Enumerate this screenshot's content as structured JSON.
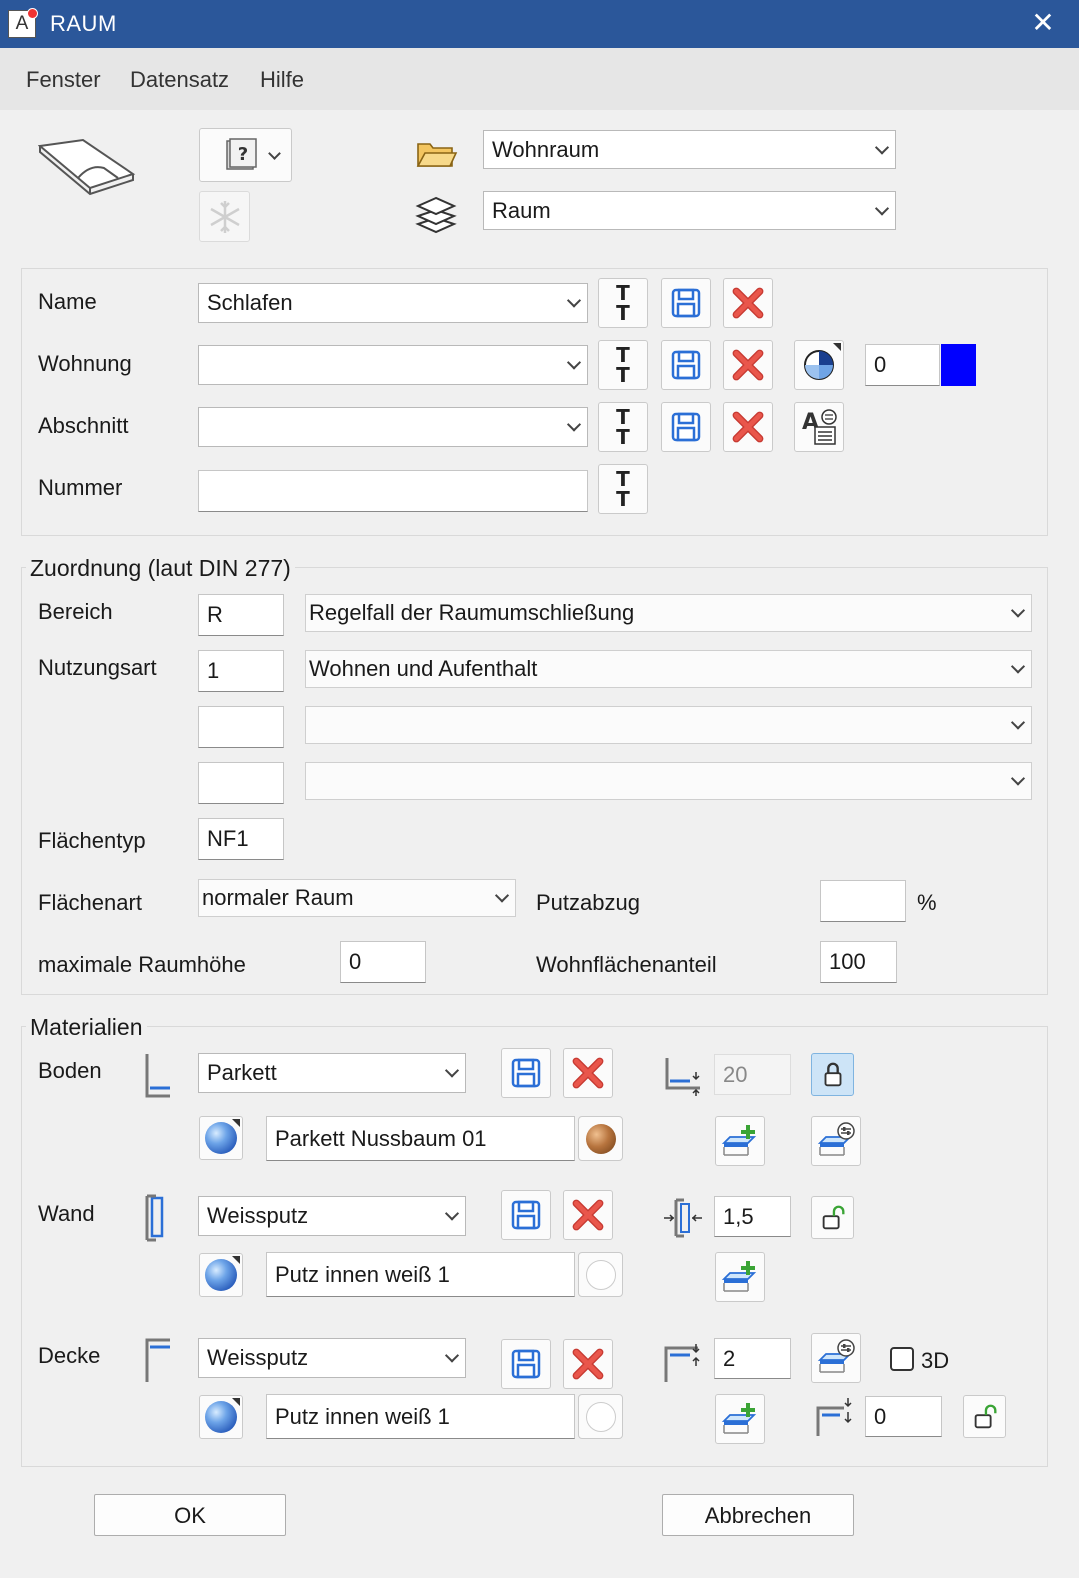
{
  "window": {
    "title": "RAUM",
    "close_glyph": "✕"
  },
  "menu": [
    "Fenster",
    "Datensatz",
    "Hilfe"
  ],
  "top": {
    "folder_value": "Wohnraum",
    "layer_value": "Raum"
  },
  "ident": {
    "name_label": "Name",
    "name_value": "Schlafen",
    "wohnung_label": "Wohnung",
    "wohnung_value": "",
    "wohnung_number": "0",
    "wohnung_color": "#0000ff",
    "abschnitt_label": "Abschnitt",
    "abschnitt_value": "",
    "nummer_label": "Nummer",
    "nummer_value": ""
  },
  "zuordnung": {
    "legend": "Zuordnung (laut DIN 277)",
    "bereich_label": "Bereich",
    "bereich_code": "R",
    "bereich_value": "Regelfall der Raumumschließung",
    "nutzungsart_label": "Nutzungsart",
    "nutzungsart_code": "1",
    "nutzungsart_value": "Wohnen und Aufenthalt",
    "extra1_code": "",
    "extra1_value": "",
    "extra2_code": "",
    "extra2_value": "",
    "flaechentyp_label": "Flächentyp",
    "flaechentyp_value": "NF1",
    "flaechenart_label": "Flächenart",
    "flaechenart_value": "normaler Raum",
    "putzabzug_label": "Putzabzug",
    "putzabzug_value": "",
    "putzabzug_unit": "%",
    "raumhoehe_label": "maximale Raumhöhe",
    "raumhoehe_value": "0",
    "wohnflaeche_label": "Wohnflächenanteil",
    "wohnflaeche_value": "100"
  },
  "materialien": {
    "legend": "Materialien",
    "boden": {
      "label": "Boden",
      "material": "Parkett",
      "texture": "Parkett Nussbaum 01",
      "thickness": "20"
    },
    "wand": {
      "label": "Wand",
      "material": "Weissputz",
      "texture": "Putz innen weiß 1",
      "thickness": "1,5"
    },
    "decke": {
      "label": "Decke",
      "material": "Weissputz",
      "texture": "Putz innen weiß 1",
      "thickness": "2",
      "offset": "0",
      "check_3d_label": "3D",
      "check_3d": false
    }
  },
  "footer": {
    "ok_label": "OK",
    "cancel_label": "Abbrechen"
  },
  "colors": {
    "titlebar": "#2b579a",
    "accent_blue": "#2b6fd6",
    "delete_red": "#d9453a",
    "add_green": "#3aa435"
  }
}
